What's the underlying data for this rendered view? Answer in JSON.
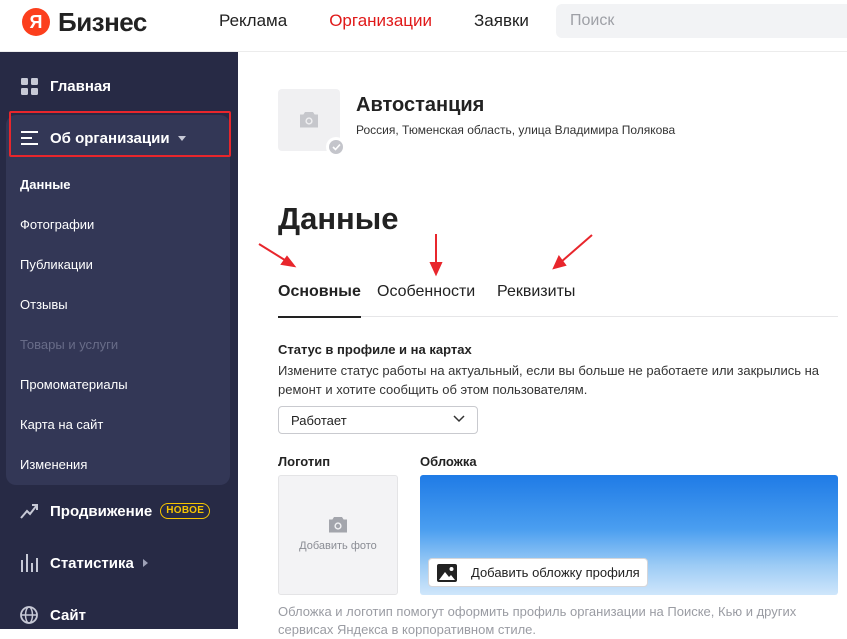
{
  "header": {
    "logo_mark": "Я",
    "logo_text": "Бизнес",
    "nav": [
      {
        "label": "Реклама"
      },
      {
        "label": "Организации"
      },
      {
        "label": "Заявки"
      }
    ],
    "search_placeholder": "Поиск"
  },
  "sidebar": {
    "home": "Главная",
    "org_section": "Об организации",
    "items": [
      {
        "label": "Данные"
      },
      {
        "label": "Фотографии"
      },
      {
        "label": "Публикации"
      },
      {
        "label": "Отзывы"
      },
      {
        "label": "Товары и услуги"
      },
      {
        "label": "Промоматериалы"
      },
      {
        "label": "Карта на сайт"
      },
      {
        "label": "Изменения"
      }
    ],
    "promo": "Продвижение",
    "promo_badge": "НОВОЕ",
    "stats": "Статистика",
    "site": "Сайт"
  },
  "org": {
    "name": "Автостанция",
    "address": "Россия, Тюменская область, улица Владимира Полякова"
  },
  "page": {
    "title": "Данные",
    "tabs": [
      {
        "label": "Основные"
      },
      {
        "label": "Особенности"
      },
      {
        "label": "Реквизиты"
      }
    ]
  },
  "status": {
    "title": "Статус в профиле и на картах",
    "description": "Измените статус работы на актуальный, если вы больше не работаете или закрылись на ремонт и хотите сообщить об этом пользователям.",
    "value": "Работает"
  },
  "media": {
    "logo_label": "Логотип",
    "cover_label": "Обложка",
    "add_photo": "Добавить фото",
    "add_cover": "Добавить обложку профиля",
    "hint": "Обложка и логотип помогут оформить профиль организации на Поиске, Кью и других сервисах Яндекса в корпоративном стиле."
  },
  "colors": {
    "accent_red": "#e01919",
    "sidebar_bg": "#272a45",
    "badge_yellow": "#f5c400",
    "annotation_red": "#e8262c"
  }
}
